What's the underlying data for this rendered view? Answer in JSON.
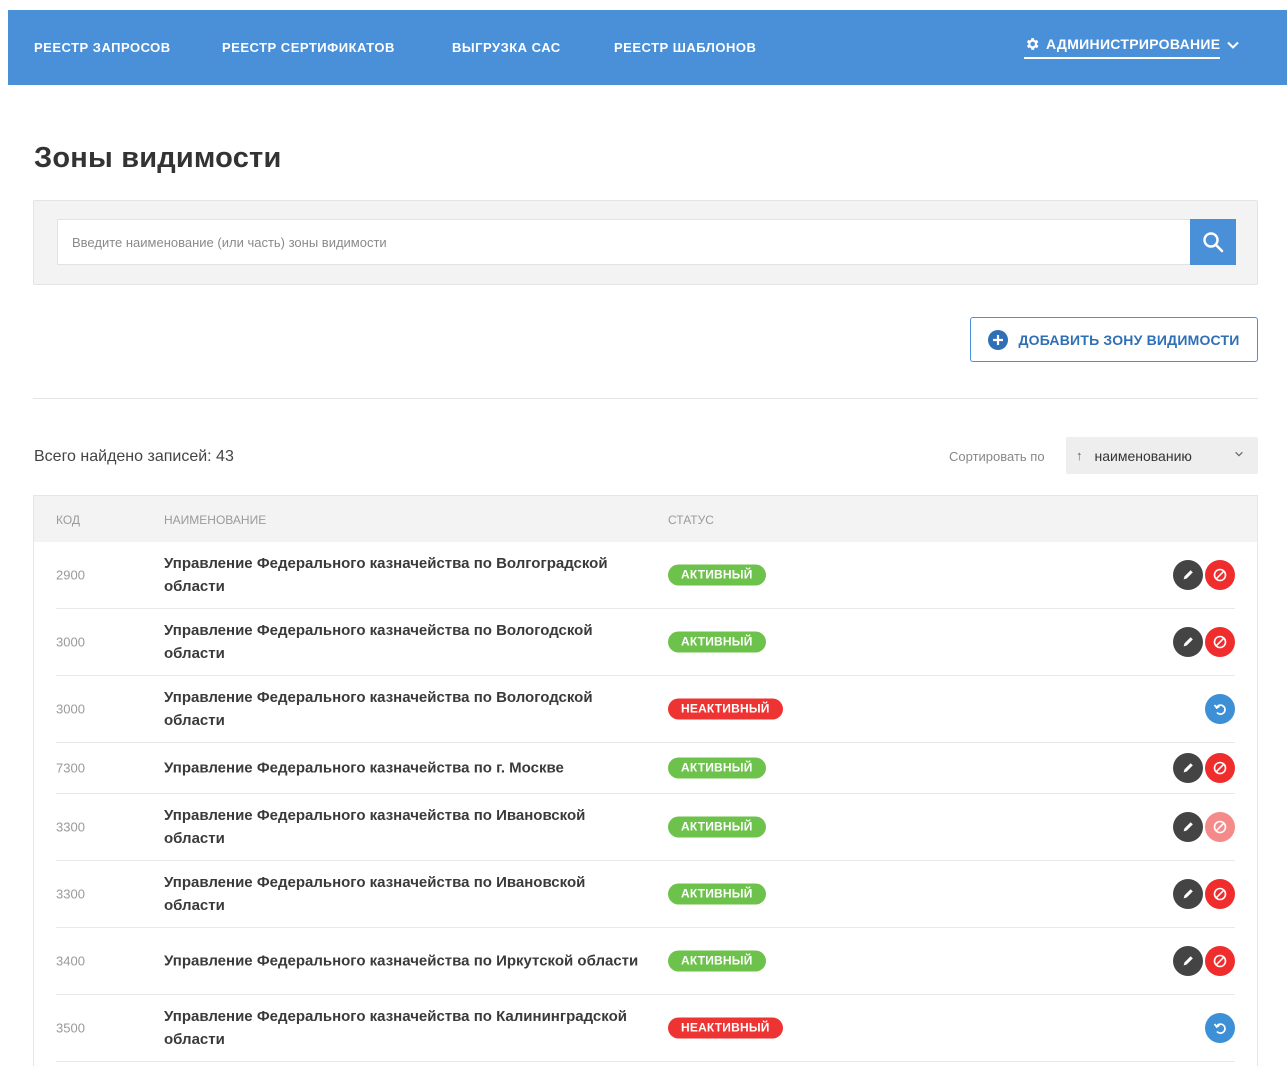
{
  "nav": {
    "items": [
      "РЕЕСТР ЗАПРОСОВ",
      "РЕЕСТР СЕРТИФИКАТОВ",
      "ВЫГРУЗКА САС",
      "РЕЕСТР ШАБЛОНОВ"
    ],
    "admin_label": "АДМИНИСТРИРОВАНИЕ",
    "admin_icon": "gear-icon",
    "color": "#4a90d9"
  },
  "page": {
    "title": "Зоны видимости"
  },
  "search": {
    "placeholder": "Введите наименование (или часть) зоны видимости",
    "value": ""
  },
  "add_button": {
    "label": "ДОБАВИТЬ ЗОНУ ВИДИМОСТИ"
  },
  "results": {
    "total_label": "Всего найдено записей: 43",
    "sort_label": "Сортировать по",
    "sort_value": "наименованию",
    "sort_direction_icon": "arrow-up-icon"
  },
  "table": {
    "headers": {
      "code": "КОД",
      "name": "НАИМЕНОВАНИЕ",
      "status": "СТАТУС"
    },
    "rows": [
      {
        "code": "2900",
        "name": "Управление Федерального казначейства по Волгоградской области",
        "status": "АКТИВНЫЙ",
        "state": "active",
        "block_faded": false
      },
      {
        "code": "3000",
        "name": "Управление Федерального казначейства по Вологодской области",
        "status": "АКТИВНЫЙ",
        "state": "active",
        "block_faded": false
      },
      {
        "code": "3000",
        "name": "Управление Федерального казначейства по Вологодской области",
        "status": "НЕАКТИВНЫЙ",
        "state": "inactive",
        "block_faded": false
      },
      {
        "code": "7300",
        "name": "Управление Федерального казначейства по г. Москве",
        "status": "АКТИВНЫЙ",
        "state": "active",
        "block_faded": false
      },
      {
        "code": "3300",
        "name": "Управление Федерального казначейства по Ивановской области",
        "status": "АКТИВНЫЙ",
        "state": "active",
        "block_faded": true
      },
      {
        "code": "3300",
        "name": "Управление Федерального казначейства по Ивановской области",
        "status": "АКТИВНЫЙ",
        "state": "active",
        "block_faded": false
      },
      {
        "code": "3400",
        "name": "Управление Федерального казначейства по Иркутской области",
        "status": "АКТИВНЫЙ",
        "state": "active",
        "block_faded": false
      },
      {
        "code": "3500",
        "name": "Управление Федерального казначейства по Калининградской области",
        "status": "НЕАКТИВНЫЙ",
        "state": "inactive",
        "block_faded": false
      }
    ]
  },
  "colors": {
    "active": "#6cc24a",
    "inactive": "#ee3333",
    "edit": "#444444",
    "block": "#f02d2d",
    "restore": "#3d8fd6"
  }
}
